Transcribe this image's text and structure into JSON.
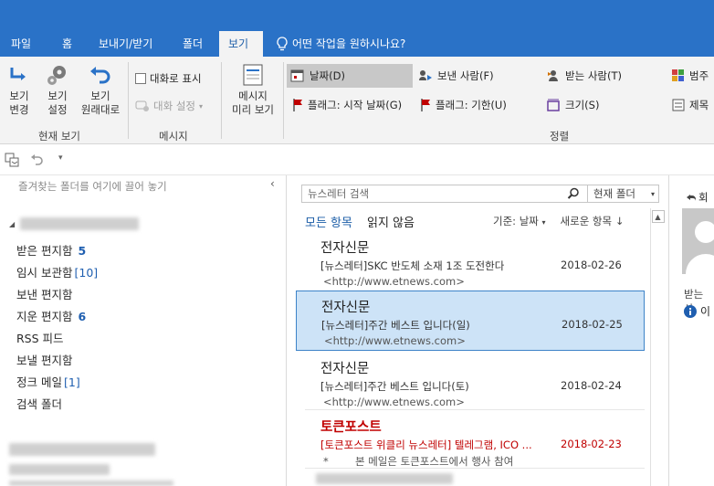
{
  "tabs": [
    {
      "label": "파일"
    },
    {
      "label": "홈"
    },
    {
      "label": "보내기/받기"
    },
    {
      "label": "폴더"
    },
    {
      "label": "보기"
    }
  ],
  "tell_me": "어떤 작업을 원하시나요?",
  "ribbon": {
    "current_view": {
      "change_view": "보기\n변경",
      "view_settings": "보기\n설정",
      "reset_view": "보기\n원래대로",
      "group_label": "현재 보기"
    },
    "messages": {
      "show_as_conversations": "대화로 표시",
      "conversation_settings": "대화 설정",
      "group_label": "메시지"
    },
    "message_preview": "메시지\n미리 보기",
    "arrangement": {
      "items": [
        {
          "label": "날짜(D)",
          "selected": true
        },
        {
          "label": "보낸 사람(F)"
        },
        {
          "label": "받는 사람(T)"
        },
        {
          "label": "범주"
        },
        {
          "label": "플래그: 시작 날짜(G)"
        },
        {
          "label": "플래그: 기한(U)"
        },
        {
          "label": "크기(S)"
        },
        {
          "label": "제목"
        }
      ],
      "group_label": "정렬"
    }
  },
  "folder_pane": {
    "favorites_hint": "즐겨찾는 폴더를 여기에 끌어 놓기",
    "folders": [
      {
        "name": "받은 편지함",
        "count": "5"
      },
      {
        "name": "임시 보관함",
        "count_bracket": "[10]"
      },
      {
        "name": "보낸 편지함"
      },
      {
        "name": "지운 편지함",
        "count": "6"
      },
      {
        "name": "RSS 피드"
      },
      {
        "name": "보낼 편지함"
      },
      {
        "name": "정크 메일",
        "count_bracket": "[1]"
      },
      {
        "name": "검색 폴더"
      }
    ]
  },
  "message_list": {
    "search_placeholder": "뉴스레터 검색",
    "search_scope": "현재 폴더",
    "filter_all": "모든 항목",
    "filter_unread": "읽지 않음",
    "sort_by": "기준: 날짜",
    "sort_order": "새로운 항목 ↓",
    "messages": [
      {
        "sender": "전자신문",
        "subject": "[뉴스레터]SKC 반도체 소재 1조 도전한다",
        "date": "2018-02-26",
        "preview": "<http://www.etnews.com>"
      },
      {
        "sender": "전자신문",
        "subject": "[뉴스레터]주간 베스트 입니다(일)",
        "date": "2018-02-25",
        "preview": "<http://www.etnews.com>"
      },
      {
        "sender": "전자신문",
        "subject": "[뉴스레터]주간 베스트 입니다(토)",
        "date": "2018-02-24",
        "preview": "<http://www.etnews.com>"
      },
      {
        "sender": "토큰포스트",
        "subject": "[토큰포스트 위클리 뉴스레터] 텔레그램, ICO ...",
        "date": "2018-02-23",
        "preview": "*        본 메일은 토큰포스트에서 행사 참여"
      }
    ]
  },
  "reading_pane": {
    "reply_label": "회",
    "recipient_label": "받는 사",
    "info_label": "이"
  },
  "colors": {
    "accent": "#2a72c7",
    "selected_bg": "#cde3f7",
    "unread_red": "#c00000",
    "count_blue": "#1f5fb0"
  }
}
